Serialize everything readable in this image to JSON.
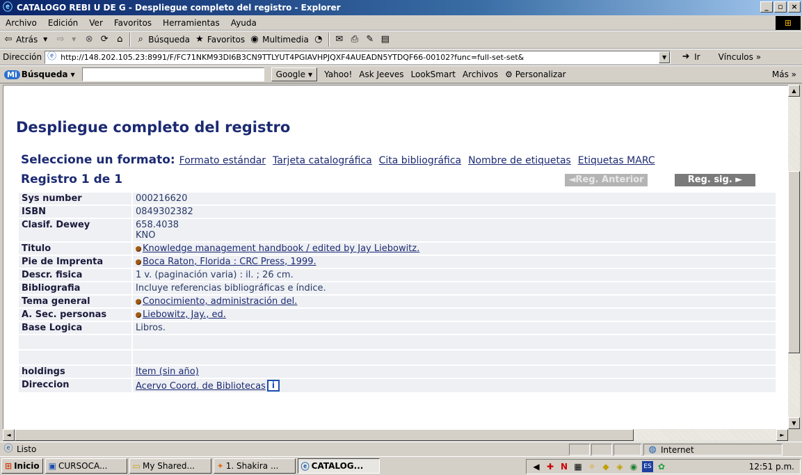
{
  "window": {
    "title": "CATALOGO REBI U DE G - Despliegue completo del registro - Explorer",
    "min": "_",
    "max": "▫",
    "close": "×"
  },
  "menu": [
    "Archivo",
    "Edición",
    "Ver",
    "Favoritos",
    "Herramientas",
    "Ayuda"
  ],
  "toolbar": {
    "back": "Atrás",
    "search": "Búsqueda",
    "favorites": "Favoritos",
    "multimedia": "Multimedia"
  },
  "address": {
    "label": "Dirección",
    "url": "http://148.202.105.23:8991/F/FC71NKM93DI6B3CN9TTLYUT4PGIAVHPJQXF4AUEADN5YTDQF66-00102?func=full-set-set&",
    "go": "Ir",
    "links": "Vínculos »"
  },
  "searchbar": {
    "brand": "Búsqueda",
    "mi": "Mi",
    "google": "Google",
    "items": [
      "Yahoo!",
      "Ask Jeeves",
      "LookSmart",
      "Archivos",
      "Personalizar"
    ],
    "more": "Más »"
  },
  "page": {
    "title": "Despliegue completo del registro",
    "format_prompt": "Seleccione un formato:",
    "formats": [
      "Formato estándar",
      "Tarjeta catalográfica",
      "Cita bibliográfica",
      "Nombre de etiquetas",
      "Etiquetas MARC"
    ],
    "record_count": "Registro 1 de 1",
    "prev": "◄Reg. Anterior",
    "next": "Reg. sig. ►"
  },
  "record": {
    "rows": [
      {
        "label": "Sys number",
        "value": "000216620"
      },
      {
        "label": "ISBN",
        "value": "0849302382"
      },
      {
        "label": "Clasif. Dewey",
        "value": "658.4038",
        "value2": "KNO"
      },
      {
        "label": "Titulo",
        "value": "Knowledge management handbook / edited by Jay Liebowitz."
      },
      {
        "label": "Pie de Imprenta",
        "value": "Boca Raton, Florida : CRC Press, 1999."
      },
      {
        "label": "Descr. fisica",
        "value": "1 v. (paginación varia) : il. ; 26 cm."
      },
      {
        "label": "Bibliografia",
        "value": "Incluye referencias bibliográficas e índice."
      },
      {
        "label": "Tema general",
        "value": "Conocimiento, administración del."
      },
      {
        "label": "A. Sec. personas",
        "value": "Liebowitz, Jay., ed."
      },
      {
        "label": "Base Logica",
        "value": "Libros."
      },
      {
        "label": "holdings",
        "value": "Item (sin año)"
      },
      {
        "label": "Direccion",
        "value": "Acervo Coord. de Bibliotecas"
      }
    ]
  },
  "status": {
    "text": "Listo",
    "zone": "Internet"
  },
  "taskbar": {
    "start": "Inicio",
    "tasks": [
      "CURSOCA...",
      "My Shared...",
      "1. Shakira ...",
      "CATALOG..."
    ],
    "clock": "12:51 p.m."
  }
}
